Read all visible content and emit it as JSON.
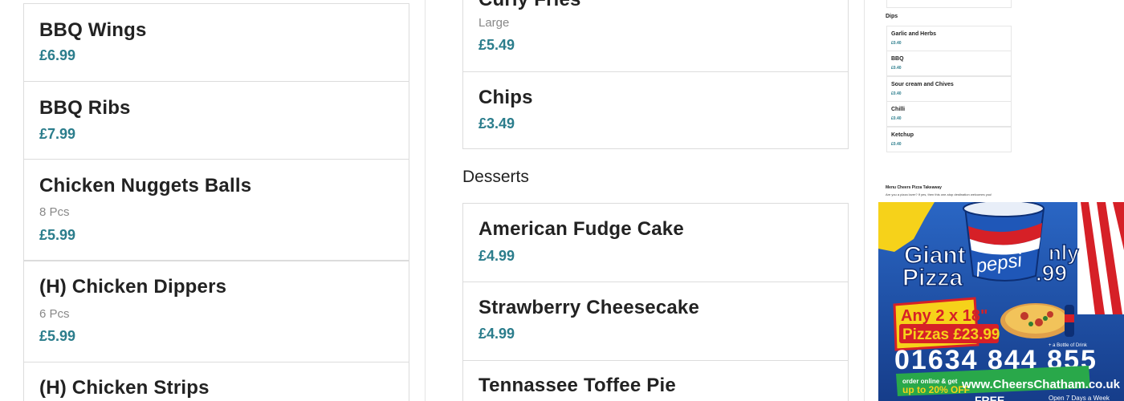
{
  "left_column": {
    "items": [
      {
        "name": "BBQ Wings",
        "price": "£6.99"
      },
      {
        "name": "BBQ Ribs",
        "price": "£7.99"
      },
      {
        "name": "Chicken Nuggets Balls",
        "desc": "8 Pcs",
        "price": "£5.99"
      },
      {
        "name": "(H) Chicken Dippers",
        "desc": "6 Pcs",
        "price": "£5.99"
      },
      {
        "name": "(H) Chicken Strips"
      }
    ]
  },
  "middle_column": {
    "top_item": {
      "name": "Curly Fries",
      "desc": "Large",
      "price": "£5.49"
    },
    "chips": {
      "name": "Chips",
      "price": "£3.49"
    },
    "desserts_title": "Desserts",
    "desserts": [
      {
        "name": "American Fudge Cake",
        "price": "£4.99"
      },
      {
        "name": "Strawberry Cheesecake",
        "price": "£4.99"
      },
      {
        "name": "Tennassee Toffee Pie"
      }
    ]
  },
  "mini_menu": {
    "dips_title": "Dips",
    "dips": [
      {
        "name": "Garlic and Herbs",
        "price": "£0.40"
      },
      {
        "name": "BBQ",
        "price": "£0.40"
      },
      {
        "name": "Sour cream and Chives",
        "price": "£0.40"
      },
      {
        "name": "Chilli",
        "price": "£0.40"
      },
      {
        "name": "Ketchup",
        "price": "£0.40"
      }
    ],
    "footer_title": "Menu Cheers Pizza Takeaway",
    "footer_text": "Are you a pizza lover? If yes, then this one-stop destination welcomes you!"
  },
  "promo": {
    "headline_1": "Giant",
    "headline_2": "Pizza",
    "headline_3": "nly",
    "headline_price": ".99",
    "cup_brand": "pepsi",
    "offer": "Any 2 x 18\"",
    "offer_2": "Pizzas £23.99",
    "drink": "+ a Bottle of Drink",
    "phone": "01634 844 855",
    "online_1": "order online & get",
    "online_2": "up to 20% OFF",
    "website": "www.CheersChatham.co.uk",
    "free": "FREE",
    "open": "Open 7 Days a Week"
  },
  "colors": {
    "price": "#2b7d8c",
    "promo_blue": "#1d4fa6",
    "promo_red": "#d62027",
    "promo_yellow": "#f6d21a",
    "promo_green": "#29a84a"
  }
}
